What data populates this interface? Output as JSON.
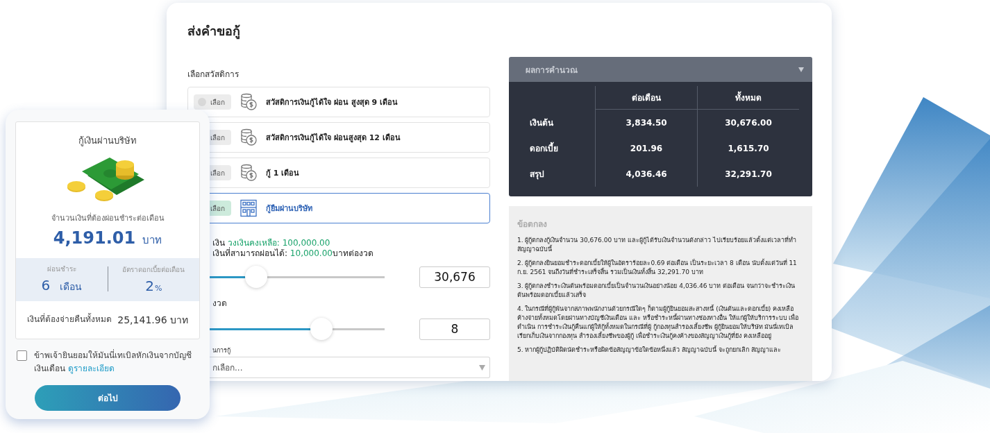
{
  "panel": {
    "title": "ส่งคำขอกู้",
    "welfare_label": "เลือกสวัสดิการ",
    "options": [
      {
        "pill": "เลือก",
        "label": "สวัสดิการเงินกู้ได้ใจ ผ่อน สูงสุด 9 เดือน",
        "kind": "welfare",
        "selected": false
      },
      {
        "pill": "เลือก",
        "label": "สวัสดิการเงินกู้ได้ใจ ผ่อนสูงสุด 12 เดือน",
        "kind": "welfare",
        "selected": false
      },
      {
        "pill": "เลือก",
        "label": "กู้ 1 เดือน",
        "kind": "welfare",
        "selected": false
      },
      {
        "pill": "เลือก",
        "label": "กู้ยืมผ่านบริษัท",
        "kind": "company",
        "selected": true
      }
    ],
    "limit_lines": [
      [
        {
          "kind": "plain",
          "text": "เงิน "
        },
        {
          "kind": "highlight",
          "text": "วงเงินคงเหลือ: 100,000.00"
        }
      ],
      [
        {
          "kind": "plain",
          "text": "เงินที่สามารถผ่อนได้: "
        },
        {
          "kind": "highlight",
          "text": "10,000.00"
        },
        {
          "kind": "plain",
          "text": "บาทต่องวด"
        }
      ]
    ],
    "amount_slider": {
      "level": 0.35,
      "value": "30,676"
    },
    "installments_label": "งวด",
    "installments_slider": {
      "level": 0.68,
      "value": "8"
    },
    "purpose_label": "นการกู้",
    "purpose_select": {
      "placeholder": "กเลือก..."
    }
  },
  "results": {
    "title": "ผลการคำนวณ",
    "columns": [
      "ต่อเดือน",
      "ทั้งหมด"
    ],
    "rows": [
      {
        "label": "เงินต้น",
        "per_month": "3,834.50",
        "total": "30,676.00"
      },
      {
        "label": "ดอกเบี้ย",
        "per_month": "201.96",
        "total": "1,615.70"
      },
      {
        "label": "สรุป",
        "per_month": "4,036.46",
        "total": "32,291.70"
      }
    ]
  },
  "terms": {
    "title": "ข้อตกลง",
    "items": [
      "1. ผู้กู้ตกลงกู้เงินจำนวน 30,676.00 บาท และผู้กู้ได้รับเงินจำนวนดังกล่าว ไปเรียบร้อยแล้วตั้งแต่เวลาที่ทำ สัญญาฉบับนี้",
      "2. ผู้กู้ตกลงยินยอมชำระดอกเบี้ยให้ผู้ในอัตราร้อยละ0.69 ต่อเดือน เป็นระยะเวลา 8 เดือน นับตั้งแต่วันที่ 11 ก.ย. 2561 จนถึงวันที่ชำระเสร็จสิ้น รวมเป็นเงินทั้งสิ้น 32,291.70 บาท",
      "3. ผู้กู้ตกลงชำระเงินต้นพร้อมดอกเบี้ยเป็นจำนวนเงินอย่างน้อย 4,036.46 บาท ต่อเดือน จนกว่าจะชำระเงินต้นพร้อมดอกเบี้ยแล้วเสร็จ",
      "4. ในกรณีที่ผู้กู้พ้นจากสภาพพนักงานด้วยกรณีใดๆ ก็ตามผู้กู้ยินยอมสะสางหนี้ (เงินต้นและดอกเบี้ย) คงเหลือ ค้างจ่ายทั้งหมดโดยผ่านทางบัญชีเงินเดือน และ หรือชำระหนี้ผ่านทางช่องทางอื่น ให้แก่ผู้ให้บริการระบบ เพื่อดำเนิน การชำระเงินกู้คืนแก่ผู้ให้กู้ทั้งหมดในกรณีที่ผู้ กู้กองทุนสำรองเลี้ยงชีพ ผู้กู้ยินยอมให้บริษัท มันนี่เทเบิลเรียกเก็บเงินจากกองทุน สำรองเลี้ยงชีพของผู้กู้ เพื่อชำระเงินกู้คงค้างของสัญญาเงินกู้ที่ยัง คงเหลืออยู่",
      "5. หากผู้กู้ปฏิบัติผิดนัดชำระหรือผิดข้อสัญญาข้อใดข้อหนึ่งแล้ว สัญญาฉบับนี้ จะถูกยกเลิก สัญญาและ"
    ]
  },
  "card": {
    "title": "กู้เงินผ่านบริษัท",
    "caption": "จำนวนเงินที่ต้องผ่อนชำระต่อเดือน",
    "amount": "4,191.01",
    "unit": "บาท",
    "stats": [
      {
        "label": "ผ่อนชำระ",
        "value": "6",
        "unit": "เดือน",
        "kind": "wide"
      },
      {
        "label": "อัตราดอกเบี้ยต่อเดือน",
        "value": "2",
        "unit": "%",
        "kind": "tight"
      }
    ],
    "total_label": "เงินที่ต้องจ่ายคืนทั้งหมด",
    "total": "25,141.96 บาท",
    "consent": {
      "checked": false,
      "text": "ข้าพเจ้ายินยอมให้มันนี่เทเบิลหักเงินจากบัญชีเงินเดือน",
      "link": "ดูรายละเอียด"
    },
    "button": "ต่อไป"
  }
}
